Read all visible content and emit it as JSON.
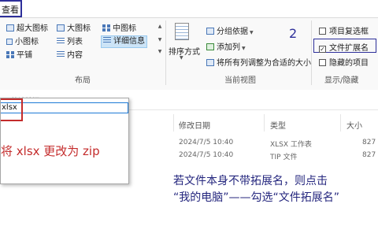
{
  "tabs": {
    "view": "查看"
  },
  "layout": {
    "items": [
      {
        "label": "超大图标",
        "icon": "extra-large-icons-icon"
      },
      {
        "label": "大图标",
        "icon": "large-icons-icon"
      },
      {
        "label": "中图标",
        "icon": "medium-icons-icon"
      },
      {
        "label": "小图标",
        "icon": "small-icons-icon"
      },
      {
        "label": "列表",
        "icon": "list-icon"
      },
      {
        "label": "详细信息",
        "icon": "details-icon",
        "selected": true
      },
      {
        "label": "平铺",
        "icon": "tiles-icon"
      },
      {
        "label": "内容",
        "icon": "content-icon"
      }
    ],
    "group_label": "布局"
  },
  "current_view": {
    "sort_label": "排序方式",
    "group_by": "分组依据",
    "add_column": "添加列",
    "fit_columns": "将所有列调整为合适的大小",
    "group_label": "当前视图"
  },
  "show_hide": {
    "item_checkboxes": {
      "label": "项目复选框",
      "checked": false
    },
    "file_extensions": {
      "label": "文件扩展名",
      "checked": true
    },
    "hidden_items": {
      "label": "隐藏的项目",
      "checked": false
    },
    "group_label": "显示/隐藏",
    "annotation_number": "2"
  },
  "addressbar": {
    "partial_text": "↗ 快速访问"
  },
  "columns": {
    "modified": "修改日期",
    "type": "类型",
    "size": "大小"
  },
  "files": [
    {
      "modified": "2024/7/5 10:40",
      "type": "XLSX 工作表",
      "size": "827"
    },
    {
      "modified": "2024/7/5 10:40",
      "type": "TIP 文件",
      "size": "827"
    }
  ],
  "rename_popup": {
    "input_value": "xlsx",
    "instruction": "将 xlsx 更改为 zip"
  },
  "note": {
    "line1": "若文件本身不带拓展名，则点击",
    "line2": "“我的电脑”——勾选“文件拓展名”"
  },
  "colors": {
    "annotation_blue": "#24267e",
    "annotation_red": "#c42b2b",
    "selection": "#cce4f7"
  }
}
